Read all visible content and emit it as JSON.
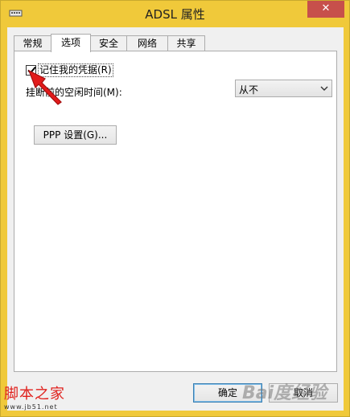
{
  "window": {
    "title": "ADSL 属性",
    "close_label": "✕"
  },
  "tabs": [
    {
      "label": "常规"
    },
    {
      "label": "选项"
    },
    {
      "label": "安全"
    },
    {
      "label": "网络"
    },
    {
      "label": "共享"
    }
  ],
  "active_tab": "选项",
  "options": {
    "remember_credentials_label": "记住我的凭据(R)",
    "remember_credentials_checked": true,
    "idle_time_label": "挂断前的空闲时间(M):",
    "idle_time_value": "从不",
    "ppp_button_label": "PPP 设置(G)..."
  },
  "footer": {
    "ok_label": "确定",
    "cancel_label": "取消"
  },
  "watermark": {
    "site_name": "脚本之家",
    "site_url": "www.jb51.net",
    "baidu_text": "Bai度经验"
  },
  "colors": {
    "titlebar": "#f0c93a",
    "close_button": "#c7504b",
    "annotation_arrow": "#e21b1b"
  }
}
